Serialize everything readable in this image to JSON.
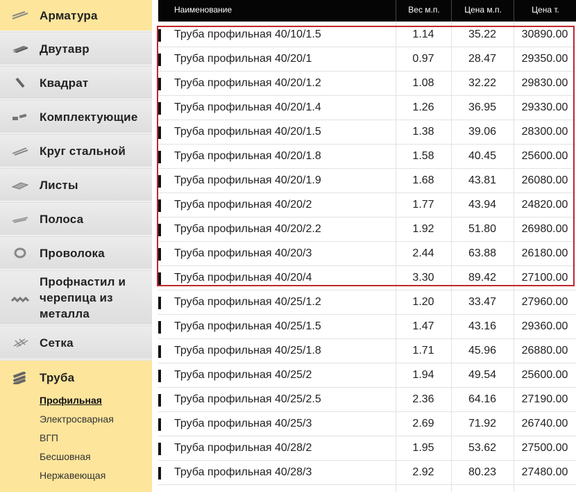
{
  "sidebar": {
    "categories": [
      {
        "label": "Арматура",
        "icon": "rebar-icon"
      },
      {
        "label": "Двутавр",
        "icon": "i-beam-icon"
      },
      {
        "label": "Квадрат",
        "icon": "square-bar-icon"
      },
      {
        "label": "Комплектующие",
        "icon": "components-icon"
      },
      {
        "label": "Круг стальной",
        "icon": "round-bar-icon"
      },
      {
        "label": "Листы",
        "icon": "sheets-icon"
      },
      {
        "label": "Полоса",
        "icon": "strip-icon"
      },
      {
        "label": "Проволока",
        "icon": "wire-coil-icon"
      },
      {
        "label": "Профнастил и черепица из металла",
        "icon": "corrugated-sheet-icon"
      },
      {
        "label": "Сетка",
        "icon": "mesh-icon"
      },
      {
        "label": "Труба",
        "icon": "pipe-icon"
      }
    ],
    "subitems": [
      "Профильная",
      "Электросварная",
      "ВГП",
      "Бесшовная",
      "Нержавеющая"
    ]
  },
  "table": {
    "headers": [
      "Наименование",
      "Вес м.п.",
      "Цена м.п.",
      "Цена т."
    ],
    "rows": [
      [
        "Труба профильная 40/10/1.5",
        "1.14",
        "35.22",
        "30890.00"
      ],
      [
        "Труба профильная 40/20/1",
        "0.97",
        "28.47",
        "29350.00"
      ],
      [
        "Труба профильная 40/20/1.2",
        "1.08",
        "32.22",
        "29830.00"
      ],
      [
        "Труба профильная 40/20/1.4",
        "1.26",
        "36.95",
        "29330.00"
      ],
      [
        "Труба профильная 40/20/1.5",
        "1.38",
        "39.06",
        "28300.00"
      ],
      [
        "Труба профильная 40/20/1.8",
        "1.58",
        "40.45",
        "25600.00"
      ],
      [
        "Труба профильная 40/20/1.9",
        "1.68",
        "43.81",
        "26080.00"
      ],
      [
        "Труба профильная 40/20/2",
        "1.77",
        "43.94",
        "24820.00"
      ],
      [
        "Труба профильная 40/20/2.2",
        "1.92",
        "51.80",
        "26980.00"
      ],
      [
        "Труба профильная 40/20/3",
        "2.44",
        "63.88",
        "26180.00"
      ],
      [
        "Труба профильная 40/20/4",
        "3.30",
        "89.42",
        "27100.00"
      ],
      [
        "Труба профильная 40/25/1.2",
        "1.20",
        "33.47",
        "27960.00"
      ],
      [
        "Труба профильная 40/25/1.5",
        "1.47",
        "43.16",
        "29360.00"
      ],
      [
        "Труба профильная 40/25/1.8",
        "1.71",
        "45.96",
        "26880.00"
      ],
      [
        "Труба профильная 40/25/2",
        "1.94",
        "49.54",
        "25600.00"
      ],
      [
        "Труба профильная 40/25/2.5",
        "2.36",
        "64.16",
        "27190.00"
      ],
      [
        "Труба профильная 40/25/3",
        "2.69",
        "71.92",
        "26740.00"
      ],
      [
        "Труба профильная 40/28/2",
        "1.95",
        "53.62",
        "27500.00"
      ],
      [
        "Труба профильная 40/28/3",
        "2.92",
        "80.23",
        "27480.00"
      ]
    ]
  },
  "colors": {
    "accent_yellow": "#fde59b",
    "header_bg": "#050505",
    "highlight_red": "#c0262c"
  }
}
